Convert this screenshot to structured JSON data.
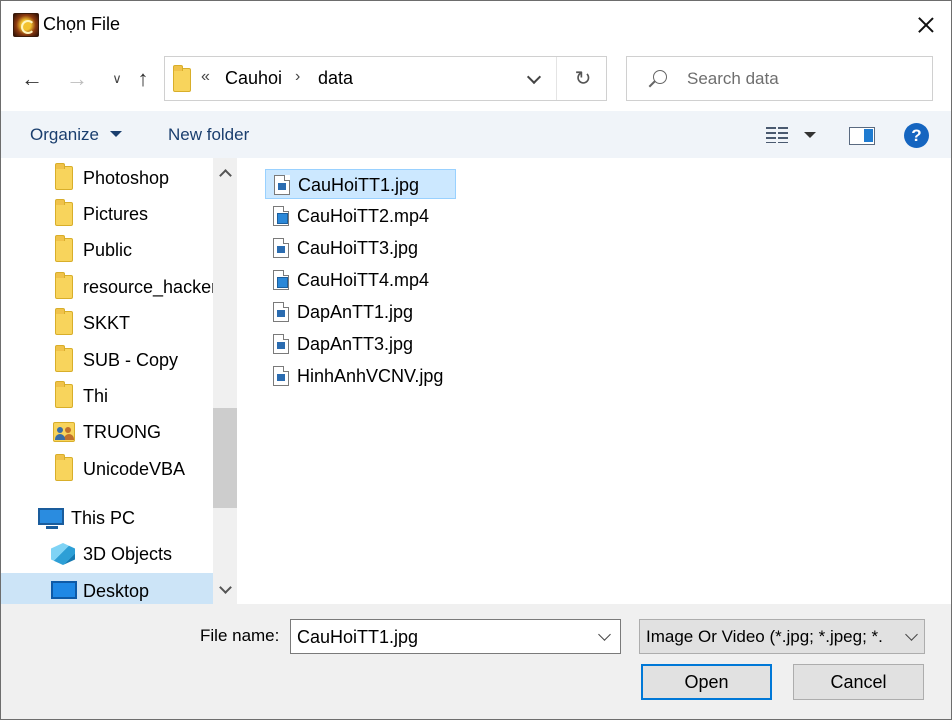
{
  "window": {
    "title": "Chọn File"
  },
  "address": {
    "overflow": "«",
    "crumbs": [
      "Cauhoi",
      "data"
    ],
    "separator": "›"
  },
  "search": {
    "placeholder": "Search data"
  },
  "toolbar": {
    "organize_label": "Organize",
    "new_folder_label": "New folder",
    "help_label": "?"
  },
  "nav_pane": {
    "items": [
      {
        "label": "Photoshop",
        "icon": "folder-icon"
      },
      {
        "label": "Pictures",
        "icon": "folder-icon"
      },
      {
        "label": "Public",
        "icon": "folder-icon"
      },
      {
        "label": "resource_hacker",
        "icon": "folder-icon"
      },
      {
        "label": "SKKT",
        "icon": "folder-icon"
      },
      {
        "label": "SUB - Copy",
        "icon": "folder-icon"
      },
      {
        "label": "Thi",
        "icon": "folder-icon"
      },
      {
        "label": "TRUONG",
        "icon": "shared-folder-icon"
      },
      {
        "label": "UnicodeVBA",
        "icon": "folder-icon"
      },
      {
        "label": "This PC",
        "icon": "pc-icon"
      },
      {
        "label": "3D Objects",
        "icon": "cube-icon"
      },
      {
        "label": "Desktop",
        "icon": "desktop-icon",
        "selected": true
      }
    ]
  },
  "files": [
    {
      "name": "CauHoiTT1.jpg",
      "type": "image",
      "selected": true
    },
    {
      "name": "CauHoiTT2.mp4",
      "type": "video"
    },
    {
      "name": "CauHoiTT3.jpg",
      "type": "image"
    },
    {
      "name": "CauHoiTT4.mp4",
      "type": "video"
    },
    {
      "name": "DapAnTT1.jpg",
      "type": "image"
    },
    {
      "name": "DapAnTT3.jpg",
      "type": "image"
    },
    {
      "name": "HinhAnhVCNV.jpg",
      "type": "image"
    }
  ],
  "footer": {
    "file_name_label": "File name:",
    "file_name_value": "CauHoiTT1.jpg",
    "file_type": "Image Or Video (*.jpg; *.jpeg; *.",
    "open_label": "Open",
    "cancel_label": "Cancel"
  },
  "colors": {
    "selection": "#cce8ff",
    "accent": "#0078d7",
    "link": "#1a3e6e"
  }
}
